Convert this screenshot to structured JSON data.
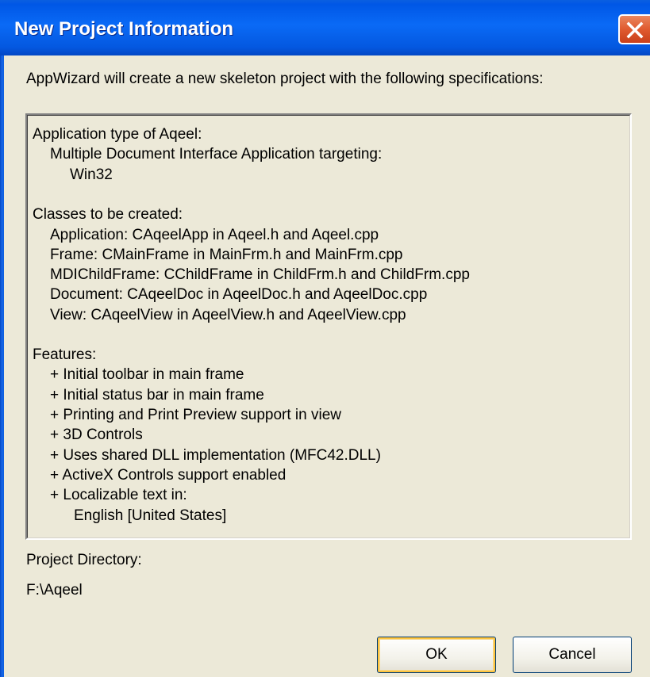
{
  "window": {
    "title": "New Project Information"
  },
  "intro_text": "AppWizard will create a new skeleton project with the following specifications:",
  "spec": {
    "app_type_heading": "Application type of Aqeel:",
    "app_type_value": "Multiple Document Interface Application targeting:",
    "app_type_platform": "Win32",
    "classes_heading": "Classes to be created:",
    "classes": [
      "Application: CAqeelApp in Aqeel.h and Aqeel.cpp",
      "Frame: CMainFrame in MainFrm.h and MainFrm.cpp",
      "MDIChildFrame: CChildFrame in ChildFrm.h and ChildFrm.cpp",
      "Document: CAqeelDoc in AqeelDoc.h and AqeelDoc.cpp",
      "View: CAqeelView in AqeelView.h and AqeelView.cpp"
    ],
    "features_heading": "Features:",
    "features": [
      "+ Initial toolbar in main frame",
      "+ Initial status bar in main frame",
      "+ Printing and Print Preview support in view",
      "+ 3D Controls",
      "+ Uses shared DLL implementation (MFC42.DLL)",
      "+ ActiveX Controls support enabled",
      "+ Localizable text in:"
    ],
    "language": "English [United States]"
  },
  "project_directory": {
    "label": "Project Directory:",
    "value": "F:\\Aqeel"
  },
  "buttons": {
    "ok_label": "OK",
    "cancel_label": "Cancel"
  },
  "icons": {
    "close": "close-icon"
  },
  "colors": {
    "titlebar": "#0a6af6",
    "close_button": "#e05a2f",
    "dialog_background": "#ece9d8"
  }
}
